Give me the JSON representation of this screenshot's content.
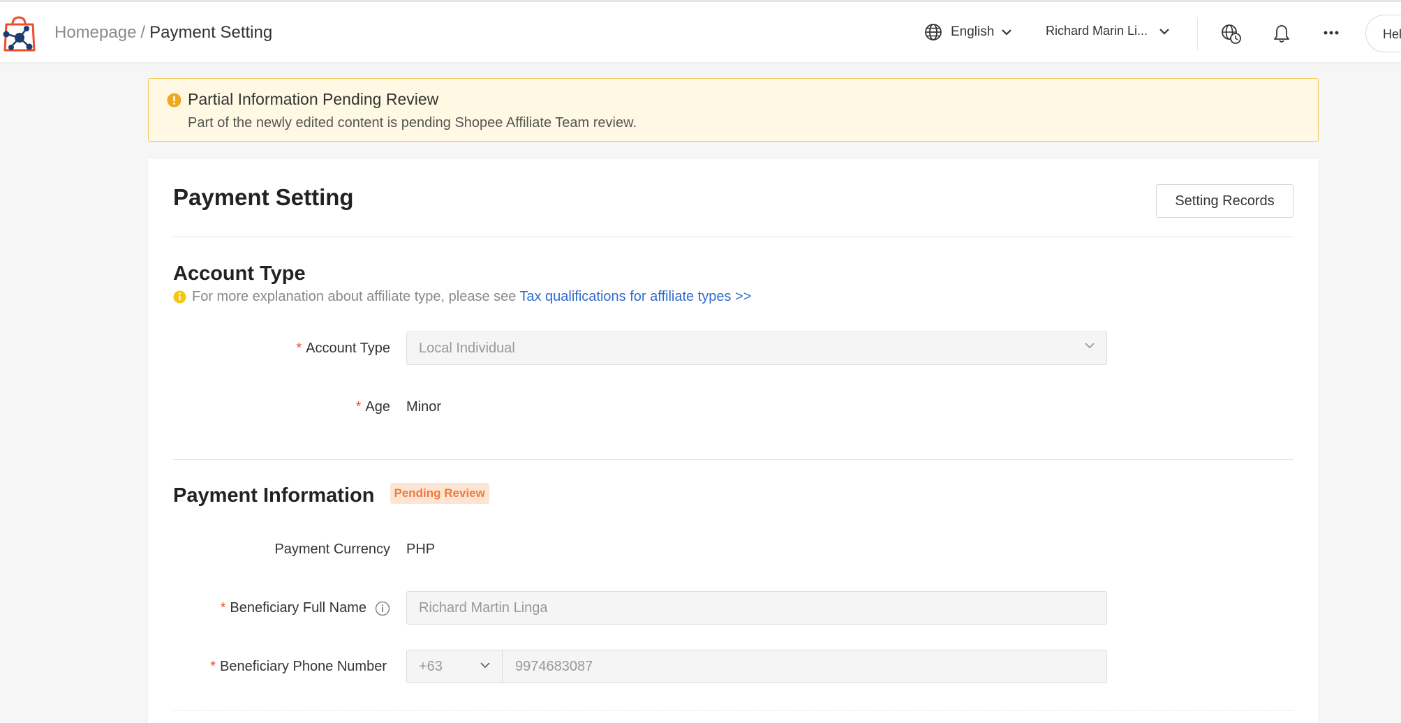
{
  "header": {
    "breadcrumb_home": "Homepage",
    "breadcrumb_separator": "/",
    "breadcrumb_current": "Payment Setting",
    "language": "English",
    "user_name": "Richard Marin Li...",
    "help_label": "Hel"
  },
  "alert": {
    "title": "Partial Information Pending Review",
    "description": "Part of the newly edited content is pending Shopee Affiliate Team review."
  },
  "page": {
    "title": "Payment Setting",
    "records_button": "Setting Records"
  },
  "account_type": {
    "section_title": "Account Type",
    "hint_text": "For more explanation about affiliate type, please see",
    "hint_link": "Tax qualifications for affiliate types >>",
    "type_label": "Account Type",
    "type_value": "Local Individual",
    "age_label": "Age",
    "age_value": "Minor"
  },
  "payment_info": {
    "section_title": "Payment Information",
    "status_badge": "Pending Review",
    "currency_label": "Payment Currency",
    "currency_value": "PHP",
    "name_label": "Beneficiary Full Name",
    "name_value": "Richard Martin Linga",
    "phone_label": "Beneficiary Phone Number",
    "phone_code": "+63",
    "phone_number": "9974683087"
  },
  "required_mark": "*",
  "colors": {
    "accent_orange": "#ee4d2d",
    "link_blue": "#2f6ccf",
    "alert_bg": "#fff8e2",
    "alert_border": "#f5c862",
    "warning_icon": "#f0a81c"
  },
  "icons": {
    "logo": "shopping-bag-network-logo",
    "language": "globe-icon",
    "timezone": "globe-clock-icon",
    "notifications": "bell-icon",
    "more": "more-dots-icon",
    "alert": "exclamation-circle-icon",
    "info": "info-circle-icon"
  }
}
